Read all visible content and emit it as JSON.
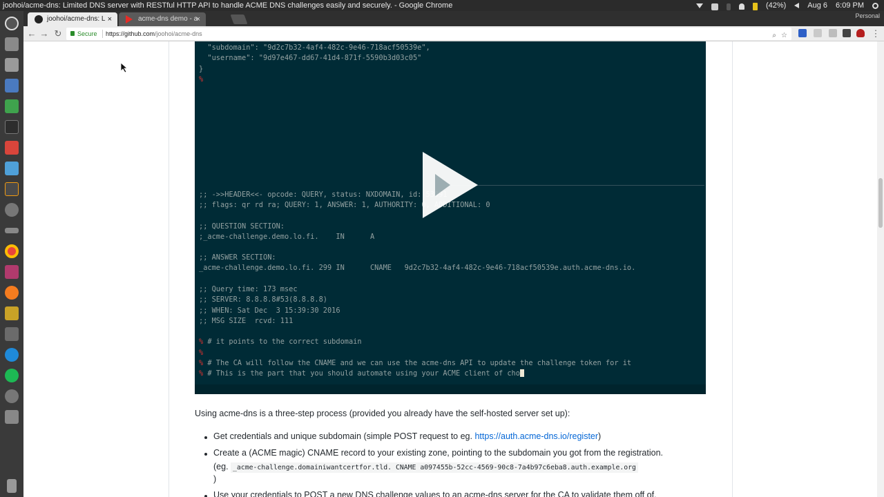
{
  "system": {
    "window_title": "joohoi/acme-dns: Limited DNS server with RESTful HTTP API to handle ACME DNS challenges easily and securely. - Google Chrome",
    "battery": "(42%)",
    "date": "Aug 6",
    "time": "6:09 PM"
  },
  "tabs": [
    {
      "label": "joohoi/acme-dns: L",
      "active": true
    },
    {
      "label": "acme-dns demo - a",
      "active": false
    }
  ],
  "profile": "Personal",
  "address_bar": {
    "secure_label": "Secure",
    "url_host": "https://github.com",
    "url_path": "/joohoi/acme-dns"
  },
  "terminal": {
    "lines_top": [
      "  \"subdomain\": \"9d2c7b32-4af4-482c-9e46-718acf50539e\",",
      "  \"username\": \"9d97e467-dd67-41d4-871f-5590b3d03c05\"",
      "}",
      "%"
    ],
    "dig_lines": [
      ";; ->>HEADER<<- opcode: QUERY, status: NXDOMAIN, id: 53091",
      ";; flags: qr rd ra; QUERY: 1, ANSWER: 1, AUTHORITY: 0, ADDITIONAL: 0",
      "",
      ";; QUESTION SECTION:",
      ";_acme-challenge.demo.lo.fi.    IN      A",
      "",
      ";; ANSWER SECTION:",
      "_acme-challenge.demo.lo.fi. 299 IN      CNAME   9d2c7b32-4af4-482c-9e46-718acf50539e.auth.acme-dns.io.",
      "",
      ";; Query time: 173 msec",
      ";; SERVER: 8.8.8.8#53(8.8.8.8)",
      ";; WHEN: Sat Dec  3 15:39:30 2016",
      ";; MSG SIZE  rcvd: 111"
    ],
    "comment_1": "# it points to the correct subdomain",
    "comment_2": "# The CA will follow the CNAME and we can use the acme-dns API to update the challenge token for it",
    "comment_3": "# This is the part that you should automate using your ACME client of cho",
    "prompt_char": "%"
  },
  "readme": {
    "intro": "Using acme-dns is a three-step process (provided you already have the self-hosted server set up):",
    "step1_text": "Get credentials and unique subdomain (simple POST request to eg. ",
    "step1_link": "https://auth.acme-dns.io/register",
    "step1_end": ")",
    "step2_text": "Create a (ACME magic) CNAME record to your existing zone, pointing to the subdomain you got from the registration.",
    "step2_prefix": "(eg. ",
    "step2_code": "_acme-challenge.domainiwantcertfor.tld. CNAME a097455b-52cc-4569-90c8-7a4b97c6eba8.auth.example.org",
    "step2_end": ")",
    "step3_text": "Use your credentials to POST a new DNS challenge values to an acme-dns server for the CA to validate them off of."
  }
}
